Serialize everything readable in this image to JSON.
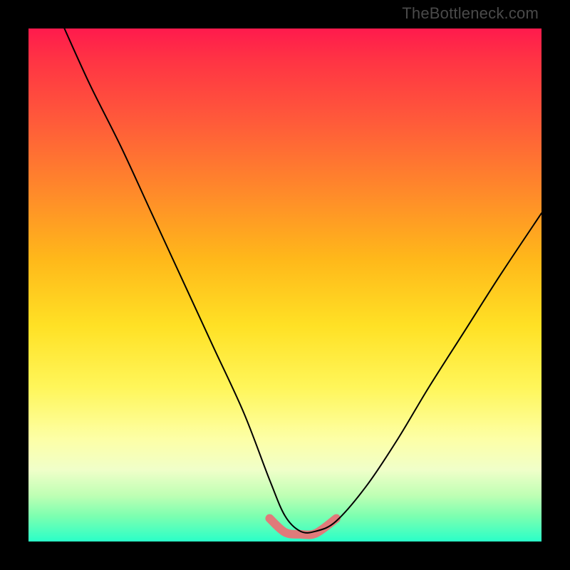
{
  "watermark": "TheBottleneck.com",
  "chart_data": {
    "type": "line",
    "title": "",
    "xlabel": "",
    "ylabel": "",
    "x_range": [
      0,
      1
    ],
    "y_range": [
      0,
      1
    ],
    "note": "No axes, ticks, or data labels are rendered; values are fractional positions within the plot area. The curve is a V-shaped profile on a red→green vertical gradient background, with a small pink trough marker near the bottom.",
    "series": [
      {
        "name": "black-curve",
        "color": "#000000",
        "stroke_width": 2,
        "x": [
          0.07,
          0.12,
          0.18,
          0.24,
          0.3,
          0.36,
          0.42,
          0.47,
          0.5,
          0.53,
          0.56,
          0.6,
          0.66,
          0.72,
          0.78,
          0.85,
          0.92,
          1.0
        ],
        "y": [
          1.0,
          0.89,
          0.77,
          0.64,
          0.51,
          0.38,
          0.25,
          0.12,
          0.05,
          0.02,
          0.02,
          0.04,
          0.11,
          0.2,
          0.3,
          0.41,
          0.52,
          0.64
        ]
      },
      {
        "name": "trough-marker",
        "color": "#e07a7a",
        "stroke_width": 12,
        "x": [
          0.47,
          0.5,
          0.53,
          0.56,
          0.6
        ],
        "y": [
          0.045,
          0.018,
          0.014,
          0.016,
          0.045
        ]
      }
    ]
  }
}
